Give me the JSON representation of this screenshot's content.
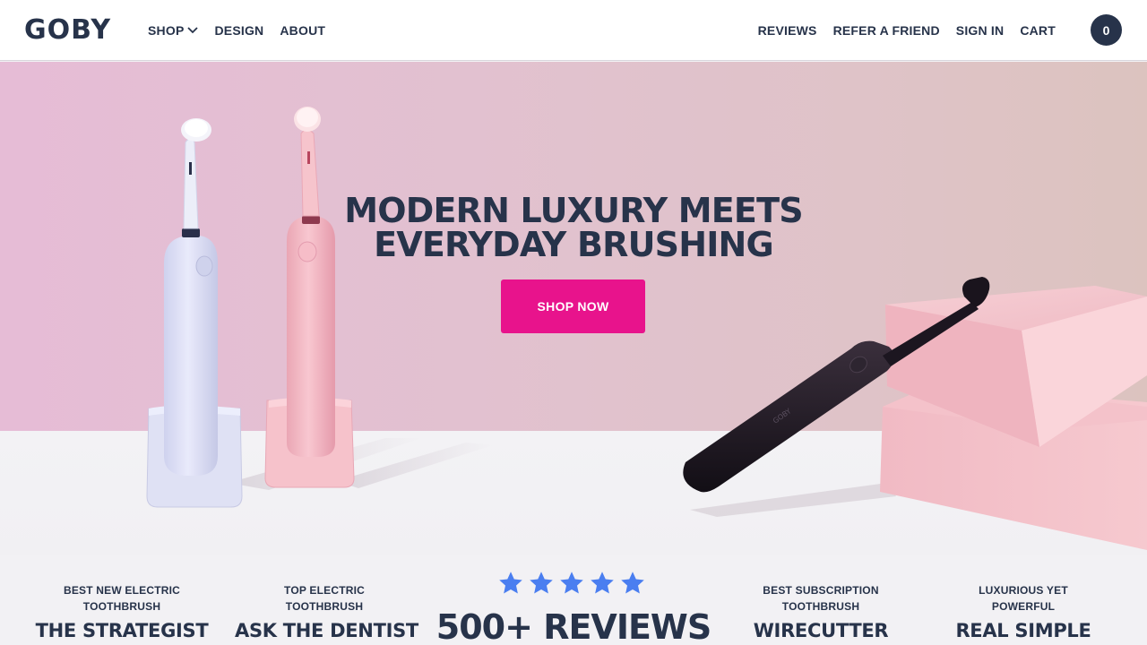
{
  "header": {
    "logo": "GOBY",
    "nav_left": [
      {
        "label": "SHOP",
        "has_dropdown": true
      },
      {
        "label": "DESIGN"
      },
      {
        "label": "ABOUT"
      }
    ],
    "nav_right": [
      {
        "label": "REVIEWS"
      },
      {
        "label": "REFER A FRIEND"
      },
      {
        "label": "SIGN IN"
      },
      {
        "label": "CART"
      }
    ],
    "cart_count": "0"
  },
  "hero": {
    "heading_line1": "MODERN LUXURY MEETS",
    "heading_line2": "EVERYDAY BRUSHING",
    "cta_label": "SHOP NOW",
    "product_imprint": "GOBY"
  },
  "press": {
    "items": [
      {
        "caption_line1": "BEST NEW ELECTRIC",
        "caption_line2": "TOOTHBRUSH",
        "source": "THE STRATEGIST"
      },
      {
        "caption_line1": "TOP ELECTRIC",
        "caption_line2": "TOOTHBRUSH",
        "source": "ASK THE DENTIST"
      },
      {
        "caption_line1": "BEST SUBSCRIPTION",
        "caption_line2": "TOOTHBRUSH",
        "source": "WIRECUTTER"
      },
      {
        "caption_line1": "LUXURIOUS YET",
        "caption_line2": "POWERFUL",
        "source": "REAL SIMPLE"
      }
    ],
    "rating_stars": 5,
    "reviews_count": "500+ REVIEWS"
  },
  "colors": {
    "navy": "#27334a",
    "cta_pink": "#e8138c",
    "star_blue": "#4a7ef0",
    "wall_pink": "#e2c1d0",
    "block_pink": "#f2c4cc",
    "brush_lavender": "#dfe1f5",
    "brush_pink": "#f4bcc6",
    "brush_black": "#1c1620"
  },
  "icons": {
    "dropdown": "chevron-down-icon",
    "star": "star-icon"
  }
}
